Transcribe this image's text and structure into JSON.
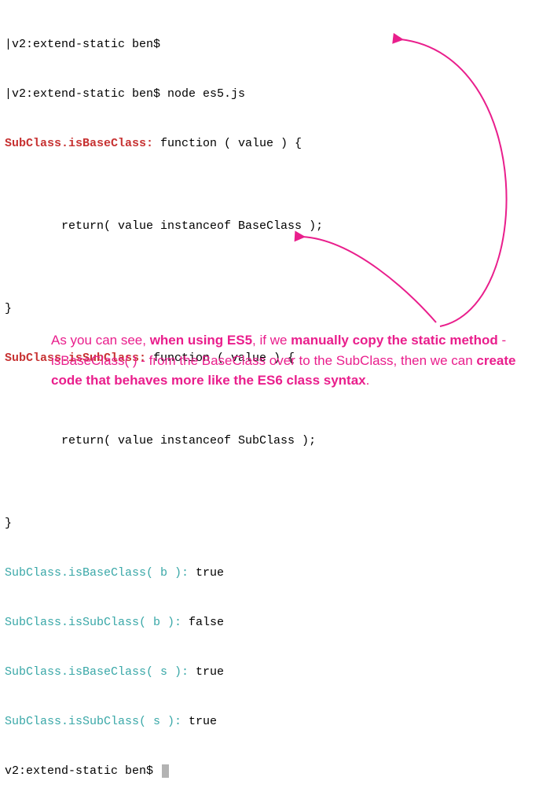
{
  "prompt1": "|v2:extend-static ben$ ",
  "prompt2_pre": "|v2:extend-static ben$ ",
  "prompt2_cmd": "node es5.js",
  "out_a_key": "SubClass.isBaseClass:",
  "out_a_rest": " function ( value ) {",
  "blank": "",
  "out_b": "        return( value instanceof BaseClass );",
  "out_c": "}",
  "out_d_key": "SubClass.isSubClass:",
  "out_d_rest": " function ( value ) {",
  "out_e": "        return( value instanceof SubClass );",
  "out_f": "}",
  "r1_key": "SubClass.isBaseClass( b ):",
  "r1_val": " true",
  "r2_key": "SubClass.isSubClass( b ):",
  "r2_val": " false",
  "r3_key": "SubClass.isBaseClass( s ):",
  "r3_val": " true",
  "r4_key": "SubClass.isSubClass( s ):",
  "r4_val": " true",
  "prompt3": "v2:extend-static ben$ ",
  "ann_1": "As you can see, ",
  "ann_2": "when using ES5",
  "ann_3": ", if we ",
  "ann_4": "manually copy the static method",
  "ann_5": " - isBaseClass( ) - from the BaseClass over to the SubClass, then we can ",
  "ann_6": "create code that behaves more like the ES6 class syntax",
  "ann_7": "."
}
